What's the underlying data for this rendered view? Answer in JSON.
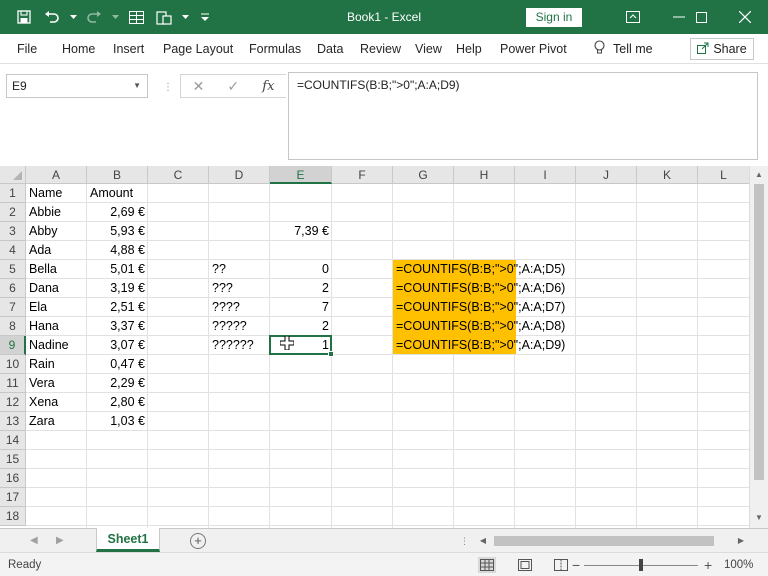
{
  "window": {
    "title": "Book1  -  Excel",
    "signin": "Sign in",
    "colors": {
      "accent": "#217346",
      "highlight": "#ffc000"
    }
  },
  "ribbon": {
    "tabs": [
      "File",
      "Home",
      "Insert",
      "Page Layout",
      "Formulas",
      "Data",
      "Review",
      "View",
      "Help",
      "Power Pivot"
    ],
    "tellme": "Tell me",
    "share": "Share"
  },
  "formula_bar": {
    "name_box": "E9",
    "fx_label": "fx",
    "formula": "=COUNTIFS(B:B;\">0\";A:A;D9)"
  },
  "grid": {
    "columns": [
      "A",
      "B",
      "C",
      "D",
      "E",
      "F",
      "G",
      "H",
      "I",
      "J",
      "K",
      "L"
    ],
    "rows": [
      "1",
      "2",
      "3",
      "4",
      "5",
      "6",
      "7",
      "8",
      "9",
      "10",
      "11",
      "12",
      "13",
      "14",
      "15",
      "16",
      "17",
      "18"
    ],
    "selected_cell": "E9",
    "col_a": [
      "Name",
      "Abbie",
      "Abby",
      "Ada",
      "Bella",
      "Dana",
      "Ela",
      "Hana",
      "Nadine",
      "Rain",
      "Vera",
      "Xena",
      "Zara"
    ],
    "col_b": [
      "Amount",
      "2,69 €",
      "5,93 €",
      "4,88 €",
      "5,01 €",
      "3,19 €",
      "2,51 €",
      "3,37 €",
      "3,07 €",
      "0,47 €",
      "2,29 €",
      "2,80 €",
      "1,03 €"
    ],
    "col_d": [
      "??",
      "???",
      "????",
      "?????",
      "??????"
    ],
    "e3": "7,39 €",
    "col_e": [
      "0",
      "2",
      "7",
      "2",
      "1"
    ],
    "col_g": [
      "=COUNTIFS(B:B;\">0\";A:A;D5)",
      "=COUNTIFS(B:B;\">0\";A:A;D6)",
      "=COUNTIFS(B:B;\">0\";A:A;D7)",
      "=COUNTIFS(B:B;\">0\";A:A;D8)",
      "=COUNTIFS(B:B;\">0\";A:A;D9)"
    ]
  },
  "sheets": {
    "tabs": [
      "Sheet1"
    ],
    "active": "Sheet1"
  },
  "status": {
    "text": "Ready",
    "zoom": "100%",
    "zoom_level": 100
  }
}
